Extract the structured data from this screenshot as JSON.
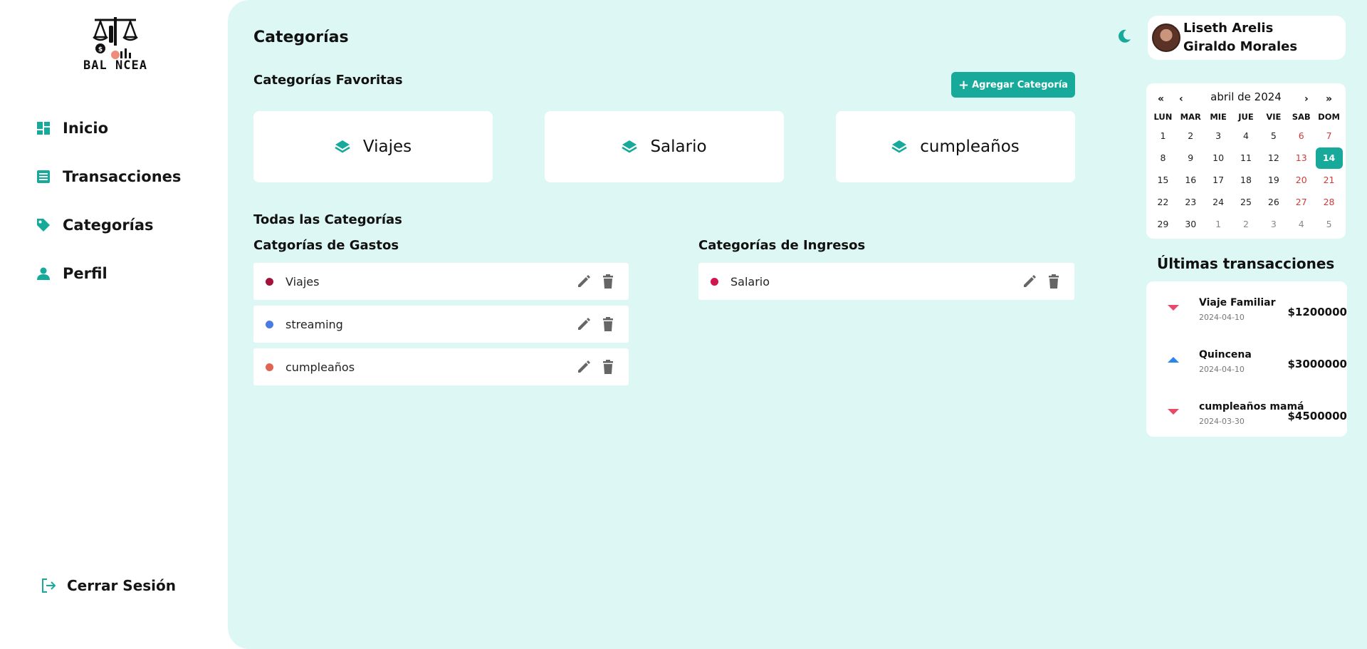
{
  "brand": {
    "logo_text": "BAL NCEA"
  },
  "sidebar": {
    "items": [
      {
        "label": "Inicio",
        "icon": "dashboard-icon"
      },
      {
        "label": "Transacciones",
        "icon": "list-icon"
      },
      {
        "label": "Categorías",
        "icon": "tag-icon"
      },
      {
        "label": "Perfil",
        "icon": "person-icon"
      }
    ],
    "logout_label": "Cerrar Sesión"
  },
  "main": {
    "title": "Categorías",
    "favorites_title": "Categorías Favoritas",
    "add_button": "Agregar Categoría",
    "favorites": [
      {
        "label": "Viajes"
      },
      {
        "label": "Salario"
      },
      {
        "label": "cumpleaños"
      }
    ],
    "all_title": "Todas las Categorías",
    "expenses_title": "Catgorías de Gastos",
    "income_title": "Categorías de Ingresos",
    "expenses": [
      {
        "label": "Viajes",
        "color": "#a3123a"
      },
      {
        "label": "streaming",
        "color": "#4a7be0"
      },
      {
        "label": "cumpleaños",
        "color": "#e0644f"
      }
    ],
    "income": [
      {
        "label": "Salario",
        "color": "#d1154f"
      }
    ]
  },
  "user": {
    "name": "Liseth Arelis Giraldo Morales"
  },
  "calendar": {
    "title": "abril de 2024",
    "nav": {
      "prev_year": "«",
      "prev": "‹",
      "next": "›",
      "next_year": "»"
    },
    "weekdays": [
      "LUN",
      "MAR",
      "MIE",
      "JUE",
      "VIE",
      "SAB",
      "DOM"
    ],
    "days": [
      "1",
      "2",
      "3",
      "4",
      "5",
      "6",
      "7",
      "8",
      "9",
      "10",
      "11",
      "12",
      "13",
      "14",
      "15",
      "16",
      "17",
      "18",
      "19",
      "20",
      "21",
      "22",
      "23",
      "24",
      "25",
      "26",
      "27",
      "28",
      "29",
      "30",
      "1",
      "2",
      "3",
      "4",
      "5"
    ],
    "today": "14"
  },
  "transactions": {
    "title": "Últimas transacciones",
    "items": [
      {
        "name": "Viaje Familiar",
        "date": "2024-04-10",
        "amount": "$1200000",
        "type": "down"
      },
      {
        "name": "Quincena",
        "date": "2024-04-10",
        "amount": "$3000000",
        "type": "up"
      },
      {
        "name": "cumpleaños mamá",
        "date": "2024-03-30",
        "amount": "$4500000",
        "type": "down"
      }
    ]
  },
  "colors": {
    "accent": "#17a99a",
    "main_bg": "#ddf8f4",
    "expense_arrow": "#e8496b",
    "income_arrow": "#2a86e8"
  }
}
